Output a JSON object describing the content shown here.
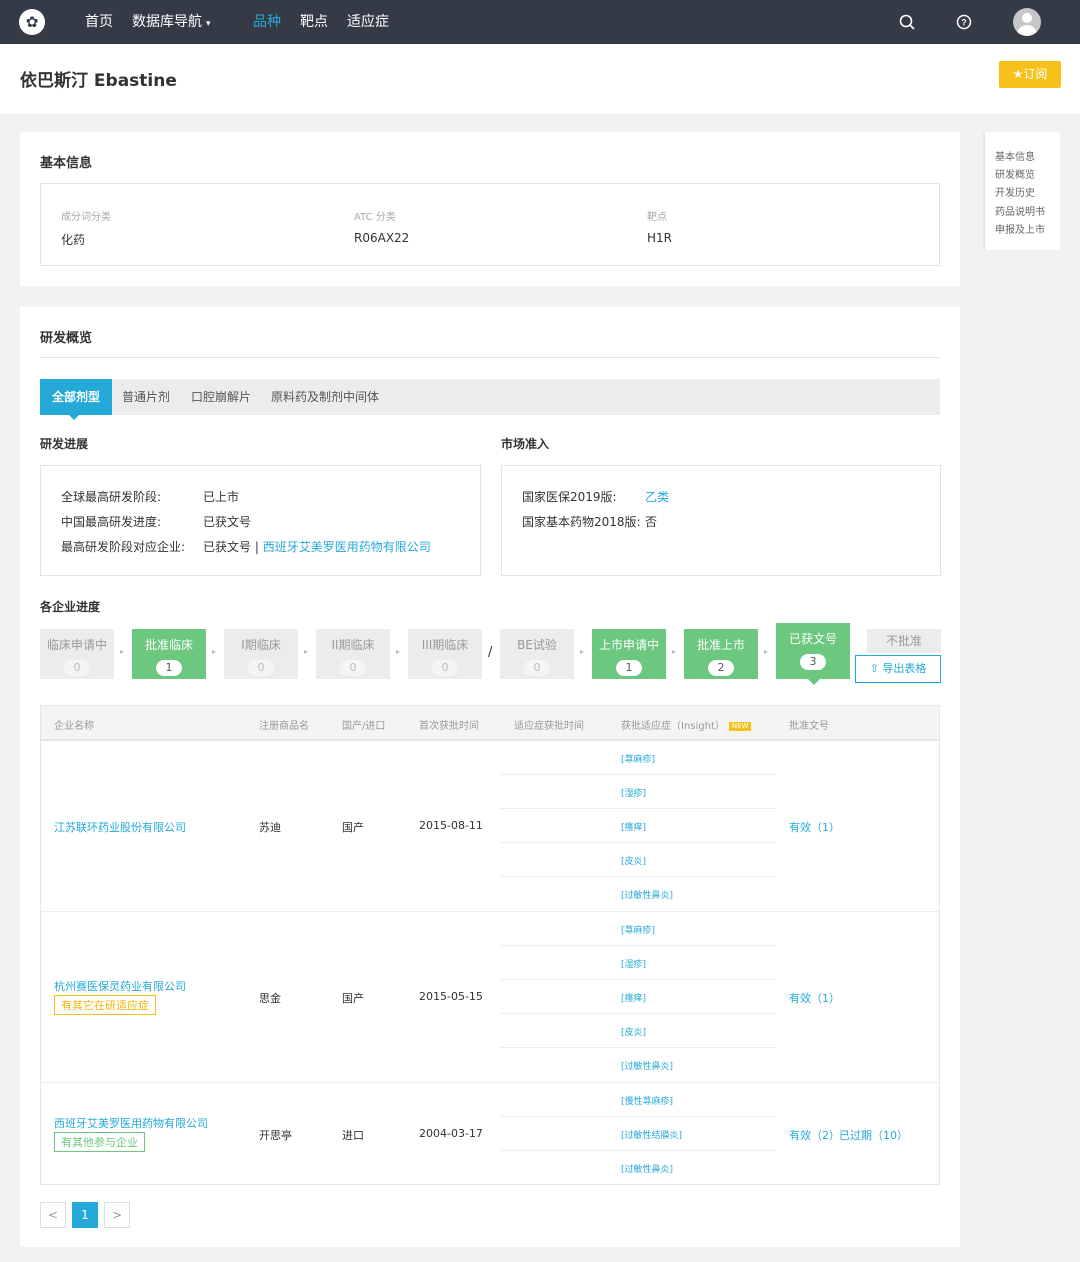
{
  "nav": {
    "items": [
      "首页",
      "数据库导航",
      "品种",
      "靶点",
      "适应症"
    ],
    "active_item": "品种"
  },
  "header": {
    "title": "依巴斯汀 Ebastine",
    "subscribe_label": "订阅"
  },
  "basic_info": {
    "title": "基本信息",
    "fields": [
      {
        "label": "成分词分类",
        "value": "化药"
      },
      {
        "label": "ATC 分类",
        "value": "R06AX22"
      },
      {
        "label": "靶点",
        "value": "H1R"
      }
    ]
  },
  "rd_overview": {
    "title": "研发概览",
    "tabs": [
      "全部剂型",
      "普通片剂",
      "口腔崩解片",
      "原料药及制剂中间体"
    ],
    "active_tab": "全部剂型",
    "progress": {
      "title": "研发进展",
      "items": [
        {
          "label": "全球最高研发阶段:",
          "value": "已上市"
        },
        {
          "label": "中国最高研发进度:",
          "value": "已获文号"
        },
        {
          "label": "最高研发阶段对应企业:",
          "value": "已获文号 |",
          "link": "西班牙艾美罗医用药物有限公司"
        }
      ]
    },
    "market": {
      "title": "市场准入",
      "items": [
        {
          "label": "国家医保2019版:",
          "value": "乙类"
        },
        {
          "label": "国家基本药物2018版:",
          "value": "否"
        }
      ]
    },
    "company_progress": {
      "title": "各企业进度",
      "stages": [
        {
          "label": "临床申请中",
          "count": "0",
          "active": false
        },
        {
          "label": "批准临床",
          "count": "1",
          "active": true
        },
        {
          "label": "I期临床",
          "count": "0",
          "active": false
        },
        {
          "label": "II期临床",
          "count": "0",
          "active": false
        },
        {
          "label": "III期临床",
          "count": "0",
          "active": false
        },
        {
          "label": "BE试验",
          "count": "0",
          "active": false
        },
        {
          "label": "上市申请中",
          "count": "1",
          "active": true
        },
        {
          "label": "批准上市",
          "count": "2",
          "active": true
        },
        {
          "label": "已获文号",
          "count": "3",
          "active": true
        }
      ],
      "reject_label": "不批准",
      "export_label": "导出表格"
    },
    "table": {
      "headers": [
        "企业名称",
        "注册商品名",
        "国产/进口",
        "首次获批时间",
        "适应症获批时间",
        "获批适应症（Insight）",
        "批准文号"
      ],
      "new_badge": "NEW",
      "rows": [
        {
          "company": "江苏联环药业股份有限公司",
          "tag": null,
          "brand": "苏迪",
          "origin": "国产",
          "first_approval": "2015-08-11",
          "indications": [
            "[荨麻疹]",
            "[湿疹]",
            "[瘙痒]",
            "[皮炎]",
            "[过敏性鼻炎]"
          ],
          "approval_no": "有效（1）",
          "approval_extra": ""
        },
        {
          "company": "杭州赛医保灵药业有限公司",
          "tag": "有其它在研适应症",
          "brand": "思金",
          "origin": "国产",
          "first_approval": "2015-05-15",
          "indications": [
            "[荨麻疹]",
            "[湿疹]",
            "[瘙痒]",
            "[皮炎]",
            "[过敏性鼻炎]"
          ],
          "approval_no": "有效（1）",
          "approval_extra": ""
        },
        {
          "company": "西班牙艾美罗医用药物有限公司",
          "tag": "有其他参与企业",
          "brand": "开思亭",
          "origin": "进口",
          "first_approval": "2004-03-17",
          "indications": [
            "[慢性荨麻疹]",
            "[过敏性结膜炎]",
            "[过敏性鼻炎]"
          ],
          "approval_no": "有效（2）",
          "approval_extra": "已过期（10）"
        }
      ]
    },
    "pagination": {
      "prev": "<",
      "current": "1",
      "next": ">"
    }
  },
  "side_nav": {
    "items": [
      "基本信息",
      "研发概览",
      "开发历史",
      "药品说明书",
      "申报及上市"
    ]
  },
  "colors": {
    "nav_bg": "#353a47",
    "accent": "#25a9d8",
    "stage_active": "#6cc77f",
    "subscribe": "#f6c11b"
  },
  "icons": [
    "logo-icon",
    "chevron-down-icon",
    "search-icon",
    "help-icon",
    "user-avatar-icon",
    "star-icon",
    "upload-icon"
  ]
}
